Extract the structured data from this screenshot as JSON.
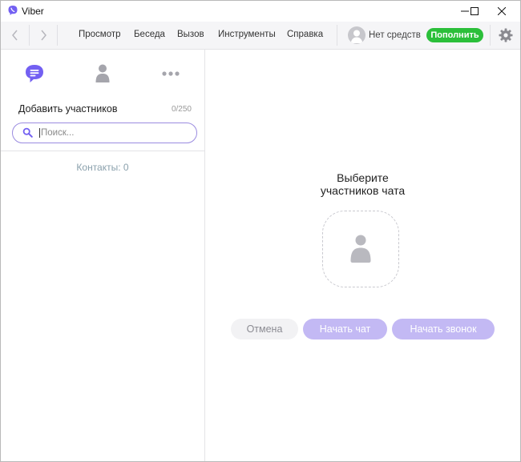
{
  "app": {
    "title": "Viber",
    "brand_color": "#7360f2"
  },
  "window_controls": {
    "minimize": "minimize-icon",
    "maximize": "maximize-icon",
    "close": "close-icon"
  },
  "menu": {
    "items": [
      "Просмотр",
      "Беседа",
      "Вызов",
      "Инструменты",
      "Справка"
    ],
    "balance_text": "Нет средств",
    "topup_label": "Пополнить",
    "topup_color": "#2bbf3a"
  },
  "sidebar_tabs": [
    {
      "name": "chats-tab",
      "icon": "chat-bubble-icon",
      "active": true
    },
    {
      "name": "contacts-tab",
      "icon": "person-icon",
      "active": false
    },
    {
      "name": "more-tab",
      "icon": "more-dots-icon",
      "active": false
    }
  ],
  "participants": {
    "title": "Добавить участников",
    "count": "0/250",
    "search_placeholder": "Поиск...",
    "contacts_label": "Контакты: 0"
  },
  "selection": {
    "title_line1": "Выберите",
    "title_line2": "участников чата",
    "cancel_label": "Отмена",
    "start_chat_label": "Начать чат",
    "start_call_label": "Начать звонок"
  }
}
